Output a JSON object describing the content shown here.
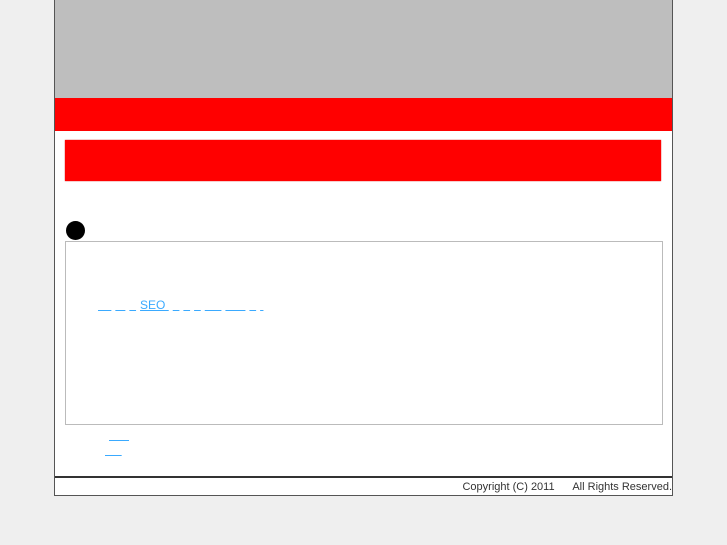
{
  "content": {
    "links": [
      "    ",
      "   ",
      "  ",
      "SEO ",
      "  ",
      "  ",
      "  ",
      "     ",
      "      ",
      "  ",
      " "
    ],
    "sub_links": [
      "      ",
      "     "
    ]
  },
  "footer": {
    "copyright": "Copyright (C) 2011",
    "rights": "All Rights Reserved."
  },
  "colors": {
    "accent": "#ff0000",
    "link": "#3aaaff",
    "header": "#bebebe"
  }
}
